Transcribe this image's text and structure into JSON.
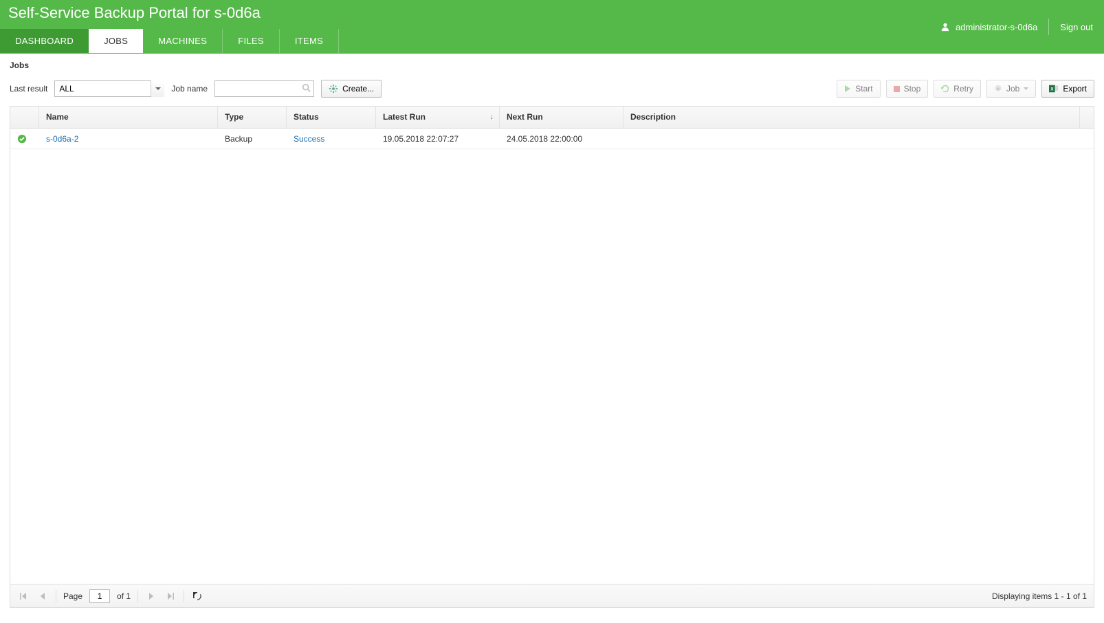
{
  "header": {
    "title": "Self-Service Backup Portal for s-0d6a",
    "tabs": [
      "DASHBOARD",
      "JOBS",
      "MACHINES",
      "FILES",
      "ITEMS"
    ],
    "active_tab": "JOBS",
    "username": "administrator-s-0d6a",
    "signout": "Sign out"
  },
  "breadcrumb": "Jobs",
  "filters": {
    "last_result_label": "Last result",
    "last_result_value": "ALL",
    "job_name_label": "Job name",
    "job_name_value": ""
  },
  "buttons": {
    "create": "Create...",
    "start": "Start",
    "stop": "Stop",
    "retry": "Retry",
    "job": "Job",
    "export": "Export"
  },
  "grid": {
    "columns": {
      "name": "Name",
      "type": "Type",
      "status": "Status",
      "latest_run": "Latest Run",
      "next_run": "Next Run",
      "description": "Description"
    },
    "rows": [
      {
        "status_icon": "success",
        "name": "s-0d6a-2",
        "type": "Backup",
        "status": "Success",
        "latest_run": "19.05.2018 22:07:27",
        "next_run": "24.05.2018 22:00:00",
        "description": ""
      }
    ]
  },
  "pager": {
    "page_label": "Page",
    "page_value": "1",
    "of_label": "of 1",
    "info": "Displaying items 1 - 1 of 1"
  }
}
